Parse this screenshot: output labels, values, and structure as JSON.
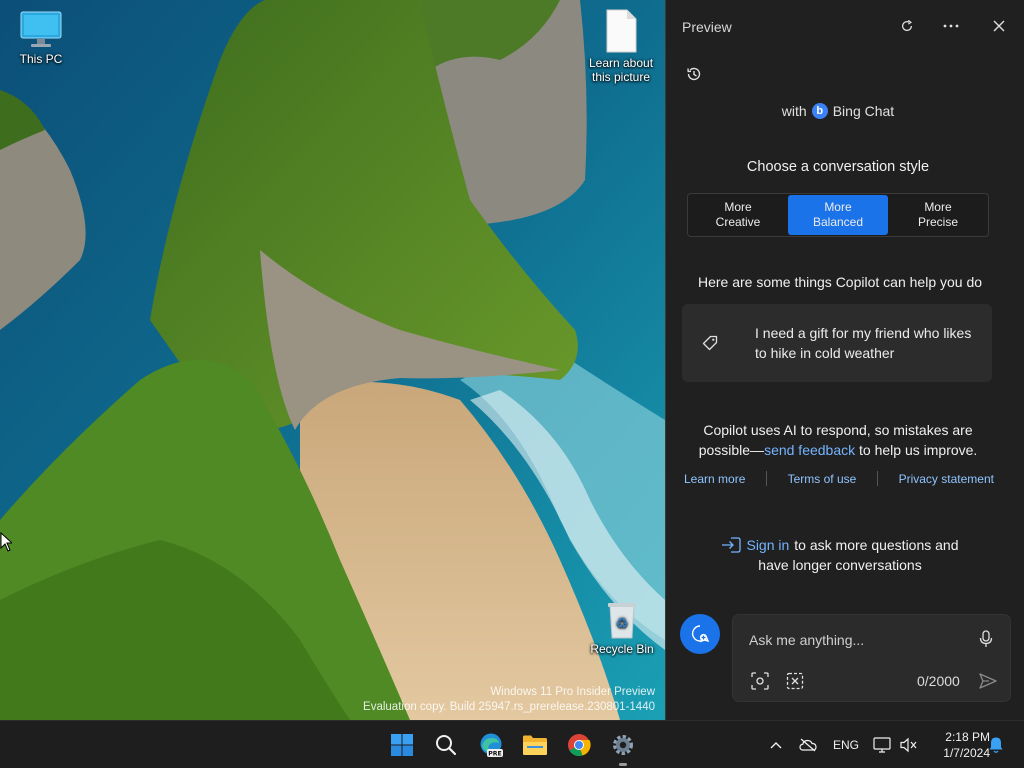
{
  "desktop": {
    "icons": {
      "this_pc": "This PC",
      "learn_line1": "Learn about",
      "learn_line2": "this picture",
      "recycle_bin": "Recycle Bin"
    },
    "watermark": {
      "line1": "Windows 11 Pro Insider Preview",
      "line2": "Evaluation copy. Build 25947.rs_prerelease.230801-1440"
    }
  },
  "panel": {
    "title": "Preview",
    "with_prefix": "with",
    "bing_chat": "Bing Chat",
    "bing_logo_letter": "b",
    "style_title": "Choose a conversation style",
    "styles": [
      {
        "line1": "More",
        "line2": "Creative"
      },
      {
        "line1": "More",
        "line2": "Balanced"
      },
      {
        "line1": "More",
        "line2": "Precise"
      }
    ],
    "help_heading": "Here are some things Copilot can help you do",
    "suggestion": "I need a gift for my friend who likes to hike in cold weather",
    "disclaimer_part1": "Copilot uses AI to respond, so mistakes are possible—",
    "disclaimer_link": "send feedback",
    "disclaimer_part2": " to help us improve.",
    "links": {
      "learn_more": "Learn more",
      "terms": "Terms of use",
      "privacy": "Privacy statement"
    },
    "signin_link": "Sign in",
    "signin_rest1": "to ask more questions and",
    "signin_rest2": "have longer conversations",
    "composer": {
      "placeholder": "Ask me anything...",
      "char_count": "0/2000"
    }
  },
  "taskbar": {
    "edge_badge": "PRE",
    "language": "ENG",
    "time": "2:18 PM",
    "date": "1/7/2024"
  },
  "colors": {
    "panel_bg": "#202020",
    "accent": "#1a73e8",
    "link": "#74b4ff",
    "taskbar_bg": "#1e1e1e"
  }
}
